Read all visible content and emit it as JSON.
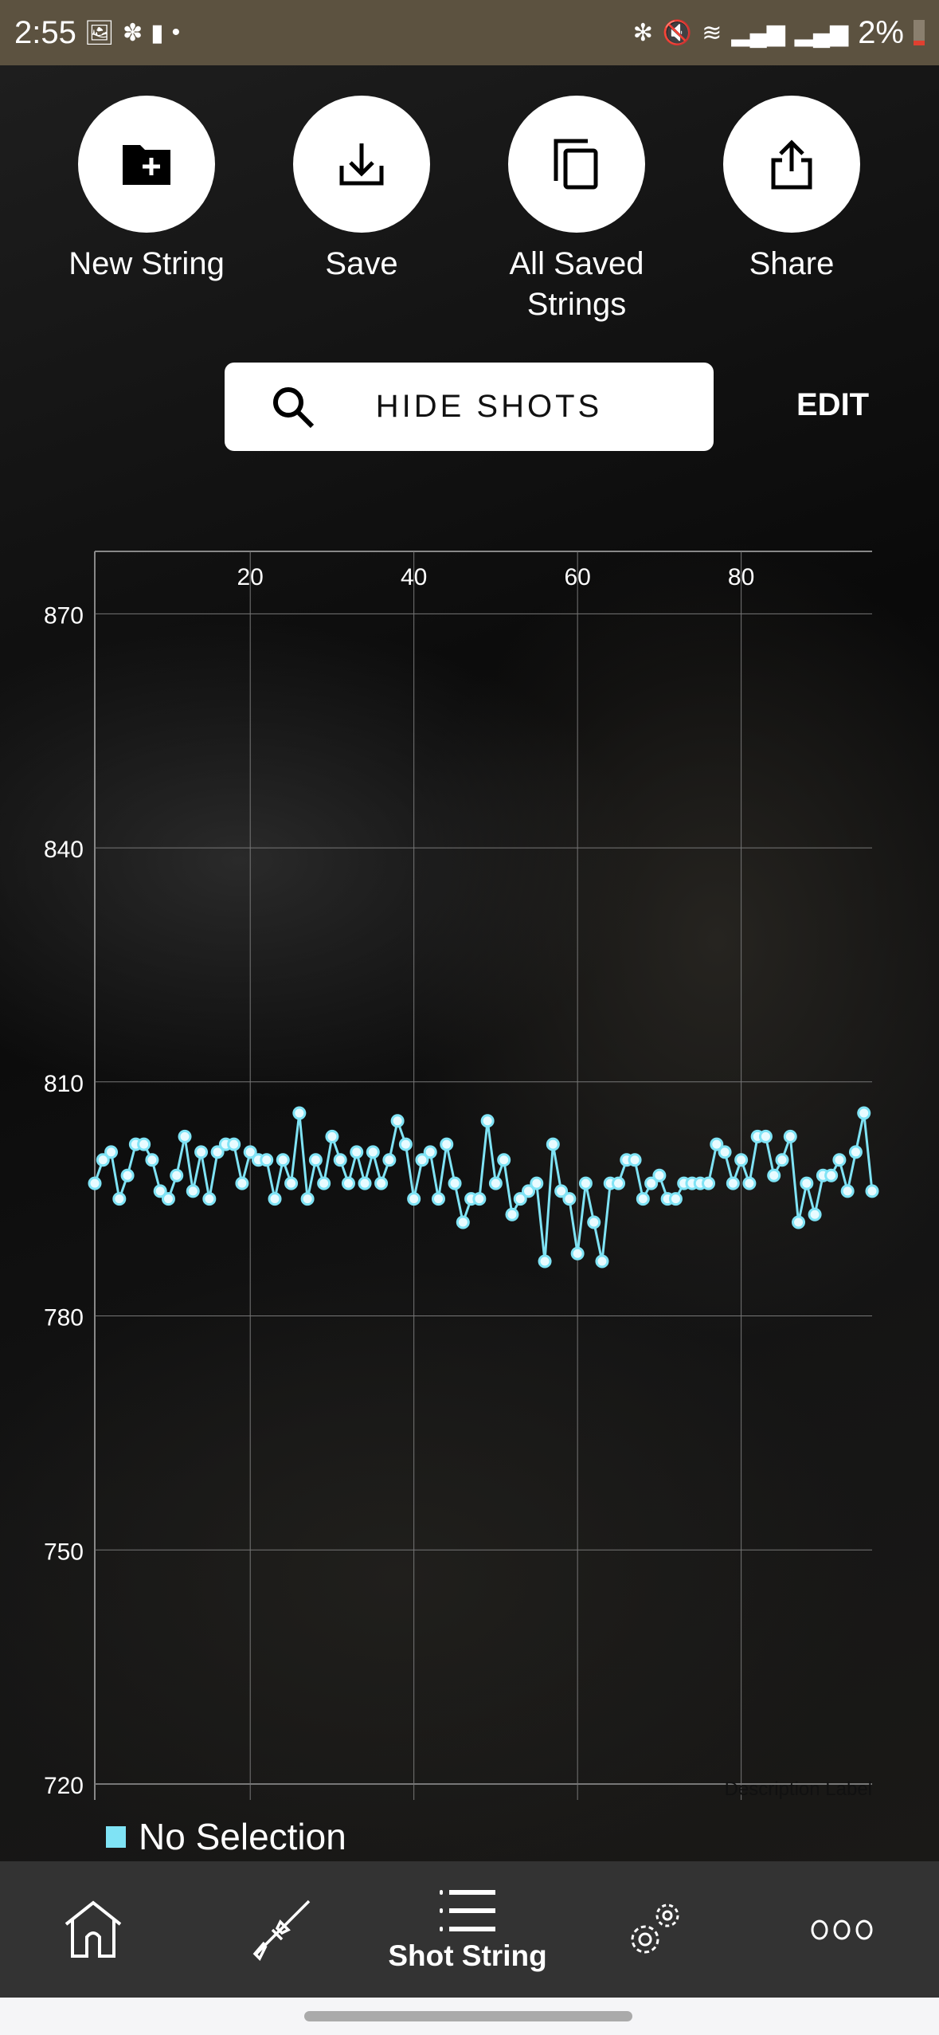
{
  "status_bar": {
    "time": "2:55",
    "battery": "2%",
    "icons": [
      "gallery-icon",
      "pinwheel-icon",
      "battery-alert-icon",
      "dot-icon",
      "bluetooth-icon",
      "mute-icon",
      "wifi-icon",
      "signal-icon",
      "signal-icon"
    ]
  },
  "actions": [
    {
      "label": "New String",
      "icon": "new-folder-icon"
    },
    {
      "label": "Save",
      "icon": "download-icon"
    },
    {
      "label": "All Saved\nStrings",
      "icon": "copy-icon"
    },
    {
      "label": "Share",
      "icon": "share-icon"
    }
  ],
  "hide_shots": {
    "label": "HIDE SHOTS",
    "icon": "search-icon"
  },
  "edit_label": "EDIT",
  "chart_data": {
    "type": "line",
    "title": "",
    "xlabel": "",
    "ylabel": "",
    "x_ticks": [
      20,
      40,
      60,
      80
    ],
    "y_ticks": [
      720,
      750,
      780,
      810,
      840,
      870
    ],
    "xlim": [
      1,
      96
    ],
    "ylim": [
      720,
      878
    ],
    "grid": true,
    "x_axis_position": "top",
    "line_color": "#7fe3f5",
    "description_label": "Description Label",
    "x": [
      1,
      2,
      3,
      4,
      5,
      6,
      7,
      8,
      9,
      10,
      11,
      12,
      13,
      14,
      15,
      16,
      17,
      18,
      19,
      20,
      21,
      22,
      23,
      24,
      25,
      26,
      27,
      28,
      29,
      30,
      31,
      32,
      33,
      34,
      35,
      36,
      37,
      38,
      39,
      40,
      41,
      42,
      43,
      44,
      45,
      46,
      47,
      48,
      49,
      50,
      51,
      52,
      53,
      54,
      55,
      56,
      57,
      58,
      59,
      60,
      61,
      62,
      63,
      64,
      65,
      66,
      67,
      68,
      69,
      70,
      71,
      72,
      73,
      74,
      75,
      76,
      77,
      78,
      79,
      80,
      81,
      82,
      83,
      84,
      85,
      86,
      87,
      88,
      89,
      90,
      91,
      92,
      93,
      94,
      95,
      96
    ],
    "values": [
      797,
      800,
      801,
      795,
      798,
      802,
      802,
      800,
      796,
      795,
      798,
      803,
      796,
      801,
      795,
      801,
      802,
      802,
      797,
      801,
      800,
      800,
      795,
      800,
      797,
      806,
      795,
      800,
      797,
      803,
      800,
      797,
      801,
      797,
      801,
      797,
      800,
      805,
      802,
      795,
      800,
      801,
      795,
      802,
      797,
      792,
      795,
      795,
      805,
      797,
      800,
      793,
      795,
      796,
      797,
      787,
      802,
      796,
      795,
      788,
      797,
      792,
      787,
      797,
      797,
      800,
      800,
      795,
      797,
      798,
      795,
      795,
      797,
      797,
      797,
      797,
      802,
      801,
      797,
      800,
      797,
      803,
      803,
      798,
      800,
      803,
      792,
      797,
      793,
      798,
      798,
      800,
      796,
      801,
      806,
      796
    ]
  },
  "legend": {
    "label": "No Selection",
    "color": "#7fe3f5"
  },
  "nav": [
    {
      "icon": "home-icon",
      "label": ""
    },
    {
      "icon": "rifle-icon",
      "label": ""
    },
    {
      "icon": "list-icon",
      "label": "Shot String"
    },
    {
      "icon": "gears-icon",
      "label": ""
    },
    {
      "icon": "more-icon",
      "label": ""
    }
  ]
}
